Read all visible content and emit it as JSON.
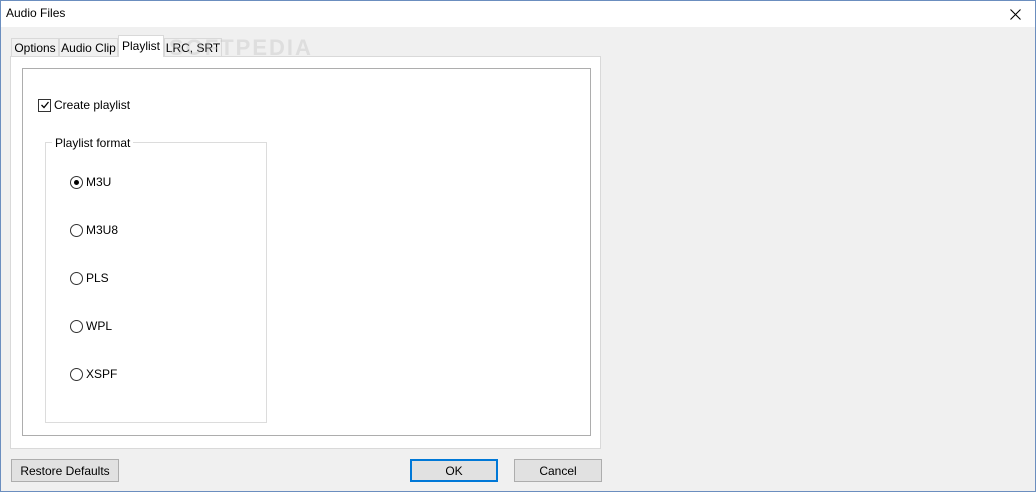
{
  "window": {
    "title": "Audio Files"
  },
  "tabs": [
    {
      "label": "Options"
    },
    {
      "label": "Audio Clip"
    },
    {
      "label": "Playlist"
    },
    {
      "label": "LRC, SRT"
    }
  ],
  "active_tab": "Playlist",
  "playlist": {
    "create_playlist_label": "Create playlist",
    "create_playlist_checked": true,
    "format_group_label": "Playlist format",
    "formats": [
      {
        "label": "M3U",
        "selected": true
      },
      {
        "label": "M3U8",
        "selected": false
      },
      {
        "label": "PLS",
        "selected": false
      },
      {
        "label": "WPL",
        "selected": false
      },
      {
        "label": "XSPF",
        "selected": false
      }
    ]
  },
  "buttons": {
    "restore_defaults": "Restore Defaults",
    "ok": "OK",
    "cancel": "Cancel"
  },
  "watermark": "SOFTPEDIA",
  "colors": {
    "default_button_border": "#0078d7",
    "window_border": "#6b8ebf"
  },
  "icons": {
    "close": "close-icon",
    "check": "checkmark-icon"
  }
}
